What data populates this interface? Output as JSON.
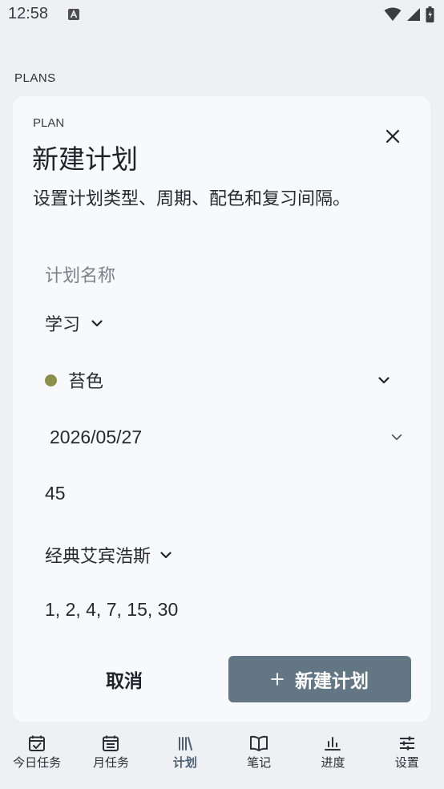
{
  "status": {
    "time": "12:58"
  },
  "section_label": "PLANS",
  "dialog": {
    "eyebrow": "PLAN",
    "title": "新建计划",
    "description": "设置计划类型、周期、配色和复习间隔。",
    "fields": {
      "name_placeholder": "计划名称",
      "type": "学习",
      "color": {
        "label": "苔色",
        "swatch": "#8b8f4b"
      },
      "date": "2026/05/27",
      "minutes": "45",
      "curve": "经典艾宾浩斯",
      "intervals": "1, 2, 4, 7, 15, 30"
    },
    "cancel_label": "取消",
    "create_label": "新建计划",
    "create_color": "#627684"
  },
  "nav": [
    {
      "label": "今日任务",
      "icon": "calendar-check-icon"
    },
    {
      "label": "月任务",
      "icon": "calendar-month-icon"
    },
    {
      "label": "计划",
      "icon": "books-icon",
      "active": true
    },
    {
      "label": "笔记",
      "icon": "open-book-icon"
    },
    {
      "label": "进度",
      "icon": "bar-chart-icon"
    },
    {
      "label": "设置",
      "icon": "sliders-icon"
    }
  ]
}
